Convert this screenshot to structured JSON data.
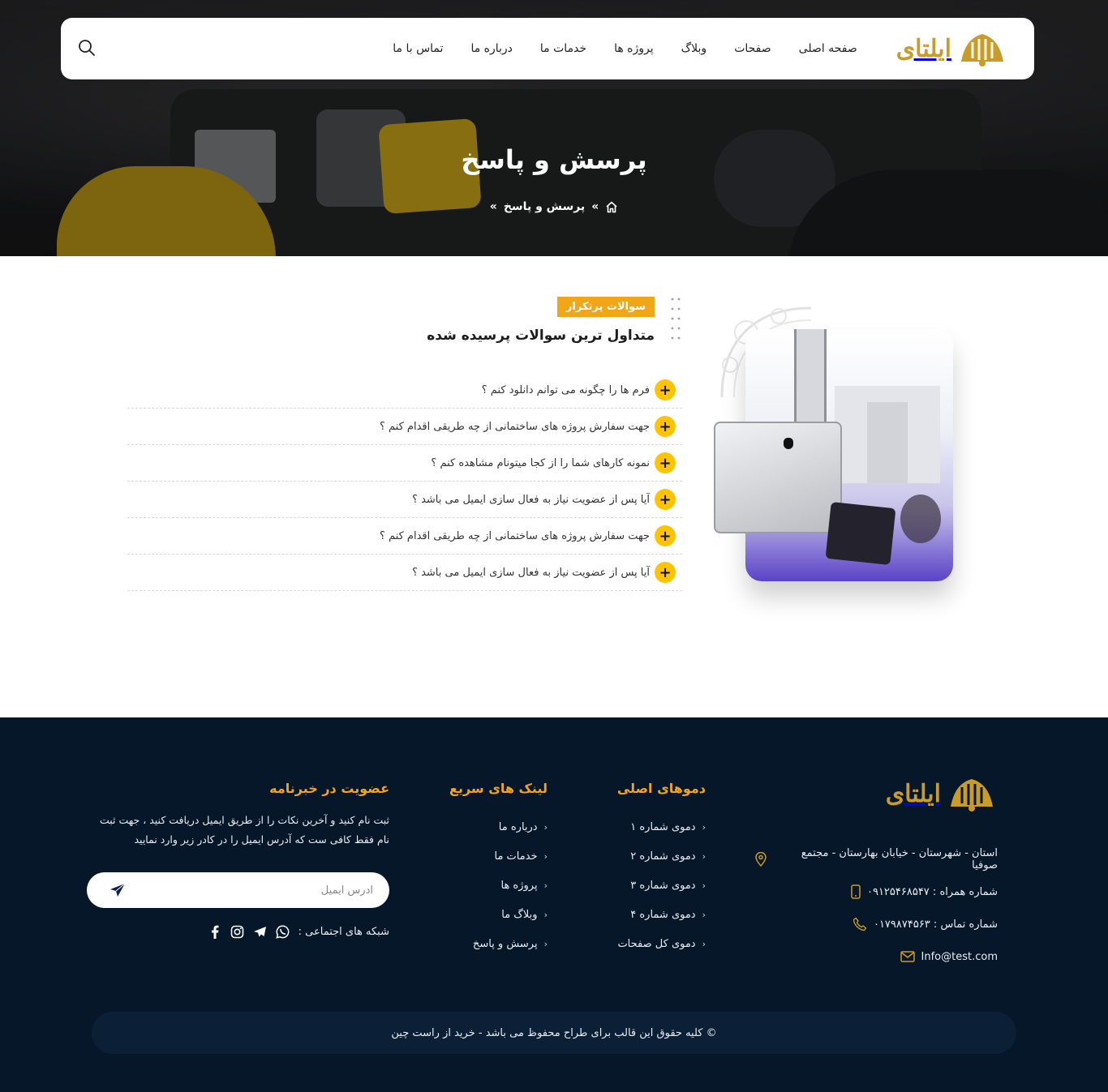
{
  "header": {
    "logo_text": "ایلتای",
    "nav": [
      "صفحه اصلی",
      "صفحات",
      "وبلاگ",
      "پروژه ها",
      "خدمات ما",
      "درباره ما",
      "تماس با ما"
    ],
    "search_icon": "search-icon"
  },
  "hero": {
    "title": "پرسش و پاسخ",
    "breadcrumb": {
      "home_icon": "home-icon",
      "separator": "»",
      "current": "پرسش و پاسخ",
      "trailing": "»"
    }
  },
  "faq": {
    "badge": "سوالات پرتکرار",
    "title": "متداول ترین سوالات پرسیده شده",
    "expand_symbol": "+",
    "items": [
      "فرم ها را چگونه می توانم دانلود کنم ؟",
      "جهت سفارش پروژه های ساختمانی از چه طریقی اقدام کنم ؟",
      "نمونه کارهای شما را از کجا میتونام مشاهده کنم ؟",
      "آیا پس از عضویت نیاز به فعال سازی ایمیل می باشد ؟",
      "جهت سفارش پروژه های ساختمانی از چه طریقی اقدام کنم ؟",
      "آیا پس از عضویت نیاز به فعال سازی ایمیل می باشد ؟"
    ]
  },
  "footer": {
    "logo_text": "ایلتای",
    "contact": {
      "address": "استان - شهرستان - خیابان بهارستان - مجتمع صوفیا",
      "mobile": "شماره همراه : ۰۹۱۲۵۴۶۸۵۴۷",
      "phone": "شماره تماس : ۰۱۷۹۸۷۴۵۶۳",
      "email": "Info@test.com"
    },
    "demos": {
      "title": "دموهای اصلی",
      "items": [
        "دموی شماره ۱",
        "دموی شماره ۲",
        "دموی شماره ۳",
        "دموی شماره ۴",
        "دموی کل صفحات"
      ]
    },
    "quick_links": {
      "title": "لینک های سریع",
      "items": [
        "درباره ما",
        "خدمات ما",
        "پروژه ها",
        "وبلاگ ما",
        "پرسش و پاسخ"
      ]
    },
    "newsletter": {
      "title": "عضویت در خبرنامه",
      "text": "ثبت نام کنید و آخرین نکات را از طریق ایمیل دریافت کنید ، جهت ثبت نام فقط کافی ست که آدرس ایمیل را در کادر زیر وارد نمایید",
      "placeholder": "آدرس ایمیل",
      "social_label": "شبکه های اجتماعی :",
      "social_icons": [
        "whatsapp-icon",
        "telegram-icon",
        "instagram-icon",
        "facebook-icon"
      ]
    },
    "copyright": "© کلیه حقوق این قالب برای طراح محفوظ می باشد -  خرید از راست چین"
  },
  "colors": {
    "accent": "#f0a616",
    "plus": "#ffc400",
    "footer_bg": "#06172a",
    "copyright_bg": "#0b2036",
    "logo_gold": "#c89b2a"
  }
}
